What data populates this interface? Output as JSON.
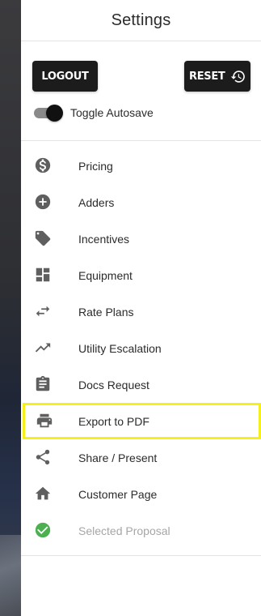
{
  "drawer": {
    "title": "Settings",
    "logout_label": "LOGOUT",
    "reset_label": "RESET",
    "autosave_label": "Toggle Autosave",
    "autosave_on": true
  },
  "menu": {
    "items": [
      {
        "label": "Pricing",
        "icon": "dollar-circle-icon"
      },
      {
        "label": "Adders",
        "icon": "plus-circle-icon"
      },
      {
        "label": "Incentives",
        "icon": "tag-icon"
      },
      {
        "label": "Equipment",
        "icon": "dashboard-icon"
      },
      {
        "label": "Rate Plans",
        "icon": "swap-arrows-icon"
      },
      {
        "label": "Utility Escalation",
        "icon": "trending-up-icon"
      },
      {
        "label": "Docs Request",
        "icon": "clipboard-icon"
      },
      {
        "label": "Export to PDF",
        "icon": "printer-icon",
        "highlighted": true
      },
      {
        "label": "Share / Present",
        "icon": "share-icon"
      },
      {
        "label": "Customer Page",
        "icon": "home-icon"
      },
      {
        "label": "Selected Proposal",
        "icon": "check-circle-icon",
        "disabled": true
      }
    ]
  },
  "colors": {
    "button_bg": "#1c1c1c",
    "icon": "#5f5f5f",
    "highlight": "#f5f01a",
    "check_green": "#4caf50"
  }
}
